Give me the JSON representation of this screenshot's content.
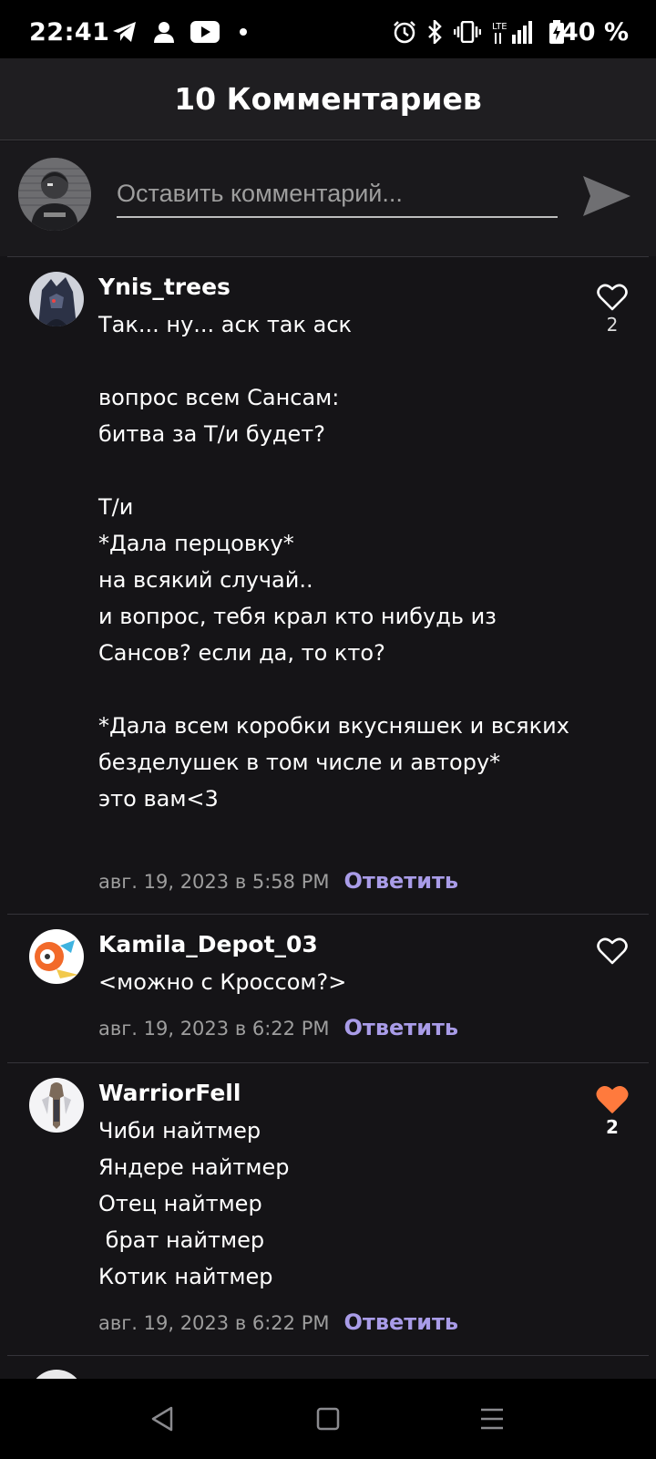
{
  "status_bar": {
    "time": "22:41",
    "battery": "40 %",
    "icons": [
      "telegram-icon",
      "person-icon",
      "youtube-icon",
      "dot-icon",
      "alarm-icon",
      "bluetooth-icon",
      "vibrate-icon",
      "lte-signal-icon",
      "battery-charging-icon"
    ]
  },
  "header": {
    "title": "10 Комментариев"
  },
  "compose": {
    "placeholder": "Оставить комментарий...",
    "send_icon": "send-icon"
  },
  "comments": [
    {
      "author": "Ynis_trees",
      "text": "Так... ну... аск так аск\n\nвопрос всем Сансам:\nбитва за Т/и будет?\n\nТ/и\n*Дала перцовку*\nна всякий случай..\nи вопрос, тебя крал кто нибудь из Сансов? если да, то кто?\n\n*Дала всем коробки вкусняшек и всяких безделушек в том числе и автору*\nэто вам<3",
      "date": "авг. 19, 2023 в 5:58 PM",
      "reply": "Ответить",
      "likes": "2",
      "liked": false
    },
    {
      "author": "Kamila_Depot_03",
      "text": "<можно с Кроссом?>",
      "date": "авг. 19, 2023 в 6:22 PM",
      "reply": "Ответить",
      "likes": "",
      "liked": false
    },
    {
      "author": "WarriorFell",
      "text": "Чиби найтмер\nЯндере найтмер\nОтец найтмер\n брат найтмер\nКотик найтмер",
      "date": "авг. 19, 2023 в 6:22 PM",
      "reply": "Ответить",
      "likes": "2",
      "liked": true
    }
  ],
  "colors": {
    "background": "#151417",
    "accent_reply": "#a99ce8",
    "liked_heart": "#ff7a3d"
  },
  "nav_bar": {
    "icons": [
      "back-icon",
      "home-icon",
      "recents-icon"
    ]
  }
}
